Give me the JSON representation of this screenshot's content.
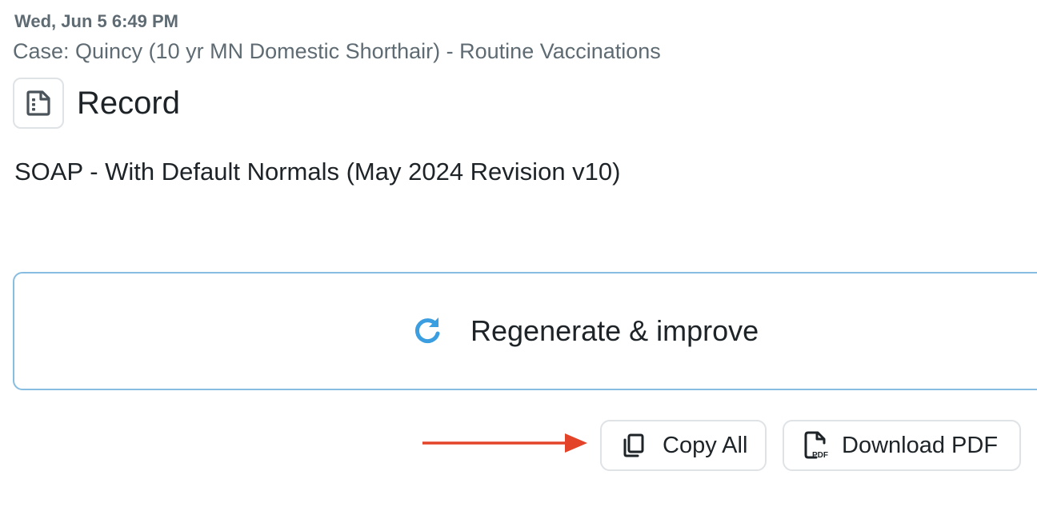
{
  "header": {
    "timestamp": "Wed, Jun 5 6:49 PM",
    "case_title": "Case: Quincy (10 yr MN Domestic Shorthair) - Routine Vaccinations"
  },
  "record": {
    "icon": "document-icon",
    "title": "Record",
    "template_name": "SOAP - With Default Normals (May 2024 Revision v10)"
  },
  "actions": {
    "regenerate": {
      "icon": "refresh-icon",
      "label": "Regenerate & improve"
    },
    "copy_all": {
      "icon": "copy-icon",
      "label": "Copy All"
    },
    "download_pdf": {
      "icon": "pdf-file-icon",
      "label": "Download PDF"
    }
  },
  "annotation": {
    "icon": "red-arrow-pointer"
  },
  "colors": {
    "refresh_icon": "#3b9ee0",
    "arrow": "#e34328",
    "regen_border": "#86bde0",
    "muted_text": "#5f6b73",
    "primary_text": "#1d2327"
  }
}
